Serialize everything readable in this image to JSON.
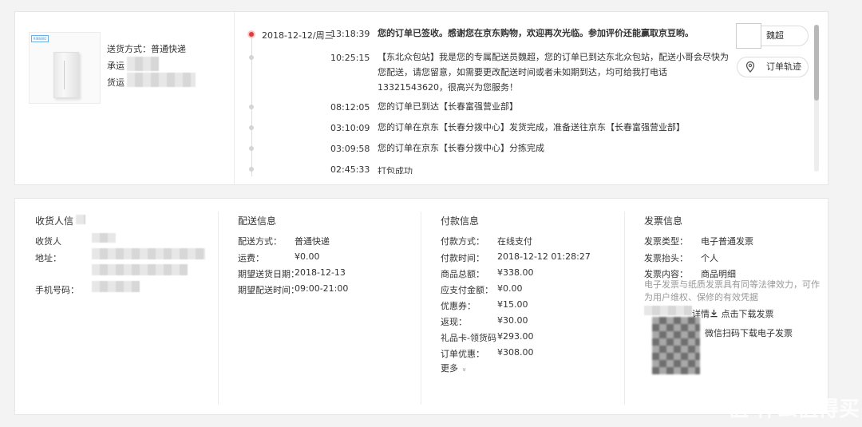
{
  "product": {
    "thumb_tag": "RINSBIO",
    "shipping_method": "送货方式：普通快递",
    "carrier_label": "承运",
    "cargo_label": "货运"
  },
  "timeline": {
    "date": "2018-12-12/周三",
    "entries": [
      {
        "time": "13:18:39",
        "text": "您的订单已签收。感谢您在京东购物，欢迎再次光临。参加评价还能赢取京豆哟。"
      },
      {
        "time": "10:25:15",
        "text": "【东北众包站】我是您的专属配送员魏超，您的订单已到达东北众包站，配送小哥会尽快为您配送，请您留意，如需要更改配送时间或者未如期到达，均可给我打电话13321543620，很高兴为您服务！"
      },
      {
        "time": "08:12:05",
        "text": "您的订单已到达【长春富强营业部】"
      },
      {
        "time": "03:10:09",
        "text": "您的订单在京东【长春分拨中心】发货完成，准备送往京东【长春富强营业部】"
      },
      {
        "time": "03:09:58",
        "text": "您的订单在京东【长春分拨中心】分拣完成"
      },
      {
        "time": "02:45:33",
        "text": "打包成功"
      }
    ],
    "courier_button": "魏超",
    "track_button": "订单轨迹"
  },
  "receiver": {
    "title": "收货人信",
    "name_label": "收货人",
    "address_label": "地址：",
    "phone_label": "手机号码："
  },
  "delivery": {
    "title": "配送信息",
    "rows": [
      {
        "label": "配送方式：",
        "value": "普通快递"
      },
      {
        "label": "运费：",
        "value": "¥0.00"
      },
      {
        "label": "期望送货日期：",
        "value": "2018-12-13"
      },
      {
        "label": "期望配送时间：",
        "value": "09:00-21:00"
      }
    ]
  },
  "payment": {
    "title": "付款信息",
    "rows": [
      {
        "label": "付款方式：",
        "value": "在线支付"
      },
      {
        "label": "付款时间：",
        "value": "2018-12-12 01:28:27"
      },
      {
        "label": "商品总额：",
        "value": "¥338.00"
      },
      {
        "label": "应支付金额：",
        "value": "¥0.00"
      },
      {
        "label": "优惠券：",
        "value": "¥15.00"
      },
      {
        "label": "返现：",
        "value": "¥30.00"
      },
      {
        "label": "礼品卡-领货码",
        "value": "¥293.00"
      },
      {
        "label": "订单优惠：",
        "value": "¥308.00"
      }
    ],
    "more": "更多",
    "more_chevron": "»"
  },
  "invoice": {
    "title": "发票信息",
    "rows": [
      {
        "label": "发票类型：",
        "value": "电子普通发票"
      },
      {
        "label": "发票抬头：",
        "value": "个人"
      },
      {
        "label": "发票内容：",
        "value": "商品明细"
      }
    ],
    "note": "电子发票与纸质发票具有同等法律效力，可作为用户维权、保修的有效凭据",
    "detail_link": "详情",
    "download": "点击下载发票",
    "wechat": "微信扫码下载电子发票"
  },
  "watermark": "值 什么值得买"
}
